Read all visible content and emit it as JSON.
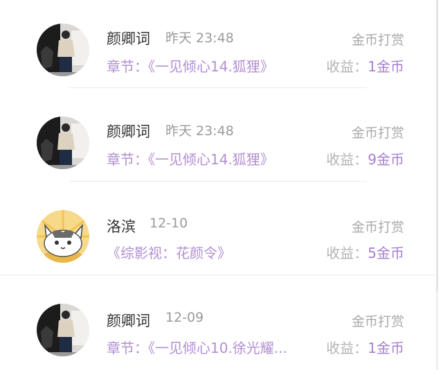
{
  "colors": {
    "name": "#333333",
    "time": "#9a9a9a",
    "reward_type": "#a9a9a9",
    "chapter": "#b28fd2",
    "earnings_label": "#b3b3b3",
    "earnings_amount": "#a57fd1"
  },
  "records": [
    {
      "avatar": "person-photo-avatar",
      "name": "颜卿词",
      "time": "昨天 23:48",
      "type": "金币打赏",
      "chapter": "章节：《一见倾心14.狐狸》",
      "earnings_label": "收益：",
      "earnings_amount": "1金币"
    },
    {
      "avatar": "person-photo-avatar",
      "name": "颜卿词",
      "time": "昨天 23:48",
      "type": "金币打赏",
      "chapter": "章节：《一见倾心14.狐狸》",
      "earnings_label": "收益：",
      "earnings_amount": "9金币"
    },
    {
      "avatar": "cat-cartoon-avatar",
      "name": "洛滨",
      "time": "12-10",
      "type": "金币打赏",
      "chapter": "《综影视：花颜令》",
      "earnings_label": "收益：",
      "earnings_amount": "5金币"
    },
    {
      "avatar": "person-photo-avatar",
      "name": "颜卿词",
      "time": "12-09",
      "type": "金币打赏",
      "chapter": "章节：《一见倾心10.徐光耀...",
      "earnings_label": "收益：",
      "earnings_amount": "1金币"
    }
  ]
}
